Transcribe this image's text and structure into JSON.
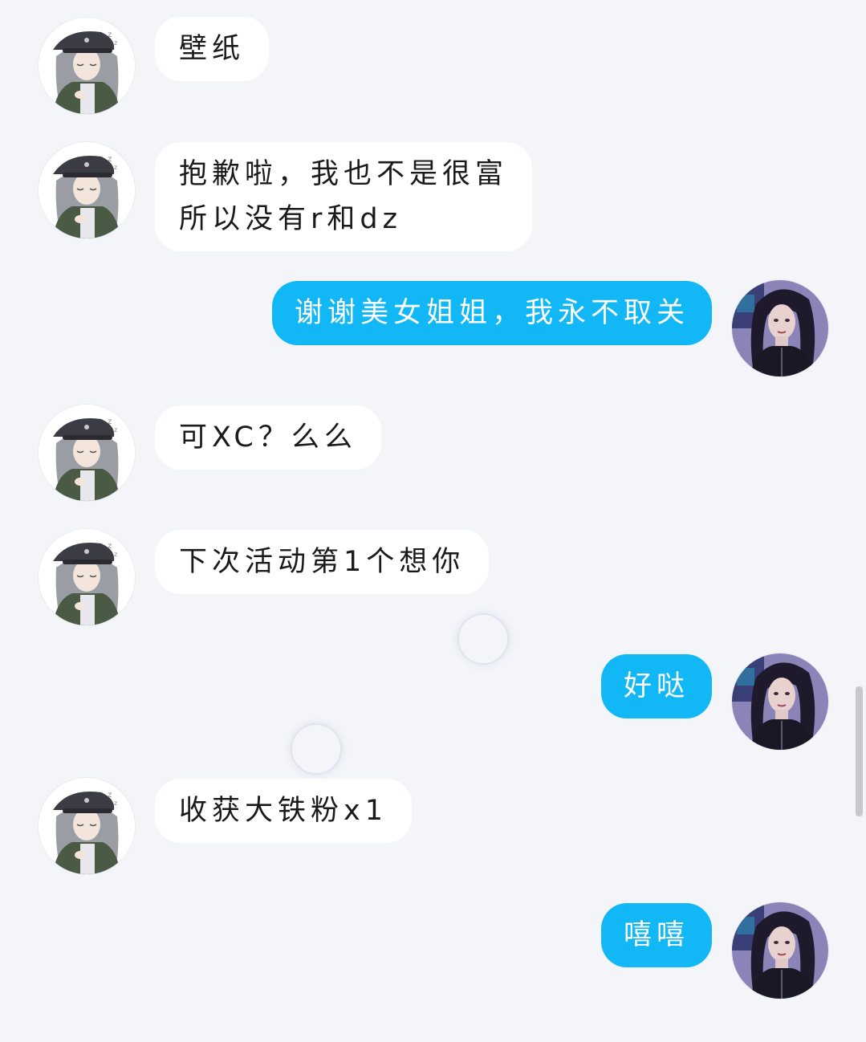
{
  "chat": {
    "messages": [
      {
        "side": "incoming",
        "text": "壁纸",
        "avatar_icon": "contact-avatar-icon"
      },
      {
        "side": "incoming",
        "text": "抱歉啦，我也不是很富\n所以没有r和dz",
        "avatar_icon": "contact-avatar-icon"
      },
      {
        "side": "outgoing",
        "text": "谢谢美女姐姐，我永不取关",
        "avatar_icon": "self-avatar-icon"
      },
      {
        "side": "incoming",
        "text": "可XC？么么",
        "avatar_icon": "contact-avatar-icon"
      },
      {
        "side": "incoming",
        "text": "下次活动第1个想你",
        "avatar_icon": "contact-avatar-icon"
      },
      {
        "side": "outgoing",
        "text": "好哒",
        "avatar_icon": "self-avatar-icon"
      },
      {
        "side": "incoming",
        "text": "收获大铁粉x1",
        "avatar_icon": "contact-avatar-icon"
      },
      {
        "side": "outgoing",
        "text": "嘻嘻",
        "avatar_icon": "self-avatar-icon"
      }
    ]
  },
  "colors": {
    "background": "#f4f5f9",
    "incoming_bubble": "#ffffff",
    "outgoing_bubble": "#12b7f5",
    "incoming_text": "#1a1a1a",
    "outgoing_text": "#ffffff"
  }
}
